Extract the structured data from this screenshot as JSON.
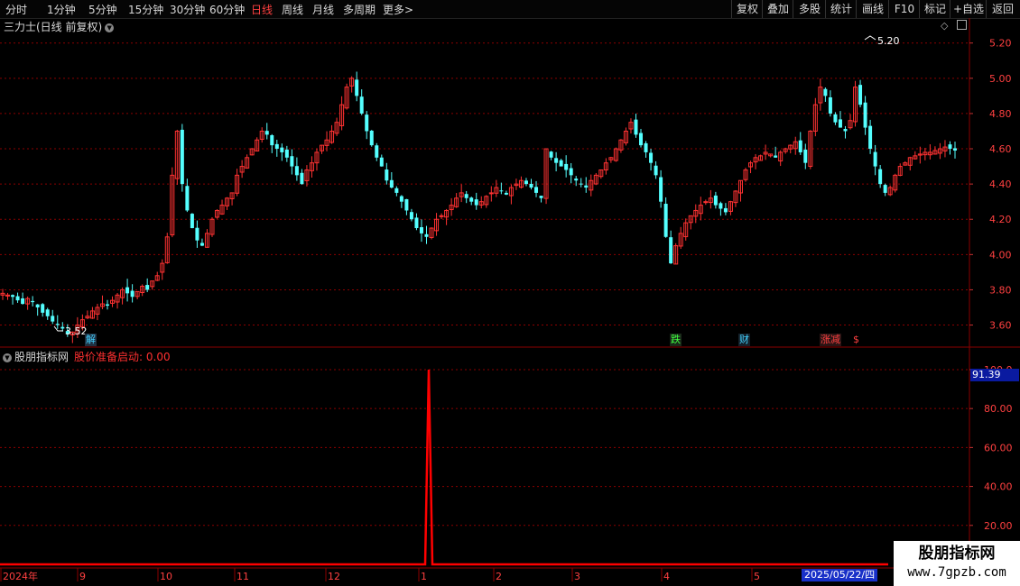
{
  "toolbar": {
    "periods": [
      {
        "label": "分时",
        "active": false
      },
      {
        "label": "1分钟",
        "active": false
      },
      {
        "label": "5分钟",
        "active": false
      },
      {
        "label": "15分钟",
        "active": false
      },
      {
        "label": "30分钟",
        "active": false
      },
      {
        "label": "60分钟",
        "active": false
      },
      {
        "label": "日线",
        "active": true
      },
      {
        "label": "周线",
        "active": false
      },
      {
        "label": "月线",
        "active": false
      },
      {
        "label": "多周期",
        "active": false
      },
      {
        "label": "更多",
        "active": false
      }
    ],
    "more_arrow": ">",
    "right_buttons": [
      "复权",
      "叠加",
      "多股",
      "统计",
      "画线",
      "F10",
      "标记",
      "+自选",
      "返回"
    ]
  },
  "stock_header": {
    "title": "三力士(日线 前复权)",
    "dropdown_icon": "chevron-down-icon"
  },
  "price_axis": {
    "ticks": [
      "5.20",
      "5.00",
      "4.80",
      "4.60",
      "4.40",
      "4.20",
      "4.00",
      "3.80",
      "3.60"
    ]
  },
  "annotations": {
    "high": "5.20",
    "low": "3.52"
  },
  "signals": [
    {
      "label": "解",
      "color": "#40d0ff"
    },
    {
      "label": "跌",
      "color": "#40ff40"
    },
    {
      "label": "财",
      "color": "#40d0ff"
    },
    {
      "label": "涨减",
      "color": "#ff4040"
    },
    {
      "label": "$",
      "color": "#ff4040"
    }
  ],
  "indicator": {
    "name": "股朋指标网",
    "formula_label": "股价准备启动:",
    "formula_value": "0.00",
    "current_value": "91.39",
    "axis_ticks": [
      "100.0",
      "80.00",
      "60.00",
      "40.00",
      "20.00"
    ]
  },
  "time_axis": {
    "labels": [
      "2024年",
      "9",
      "10",
      "11",
      "12",
      "1",
      "2",
      "3",
      "4",
      "5"
    ],
    "cursor_date": "2025/05/22/四"
  },
  "watermark": {
    "title": "股朋指标网",
    "url": "www.7gpzb.com"
  },
  "colors": {
    "up": "#ff3232",
    "down": "#54ffff",
    "grid": "#8b0000",
    "signal_line": "#ff0000"
  },
  "chart_data": [
    {
      "type": "candlestick",
      "title": "三力士(日线 前复权)",
      "y_axis_ticks": [
        5.2,
        5.0,
        4.8,
        4.6,
        4.4,
        4.2,
        4.0,
        3.8,
        3.6
      ],
      "ylim": [
        3.48,
        5.26
      ],
      "x_axis_labels": [
        "2024年",
        "9",
        "10",
        "11",
        "12",
        "1",
        "2",
        "3",
        "4",
        "5"
      ],
      "high_marker": 5.2,
      "low_marker": 3.52,
      "close_series": [
        3.78,
        3.77,
        3.76,
        3.74,
        3.72,
        3.75,
        3.73,
        3.7,
        3.67,
        3.65,
        3.62,
        3.6,
        3.58,
        3.55,
        3.56,
        3.6,
        3.63,
        3.65,
        3.68,
        3.7,
        3.72,
        3.71,
        3.74,
        3.77,
        3.8,
        3.78,
        3.76,
        3.79,
        3.82,
        3.8,
        3.85,
        3.88,
        3.95,
        4.1,
        4.45,
        4.7,
        4.4,
        4.25,
        4.15,
        4.08,
        4.05,
        4.12,
        4.2,
        4.25,
        4.28,
        4.32,
        4.35,
        4.45,
        4.5,
        4.55,
        4.6,
        4.65,
        4.7,
        4.68,
        4.62,
        4.6,
        4.58,
        4.55,
        4.5,
        4.45,
        4.4,
        4.48,
        4.52,
        4.58,
        4.62,
        4.65,
        4.7,
        4.75,
        4.85,
        4.95,
        5.0,
        4.9,
        4.8,
        4.7,
        4.62,
        4.55,
        4.5,
        4.42,
        4.38,
        4.35,
        4.3,
        4.25,
        4.2,
        4.15,
        4.12,
        4.1,
        4.15,
        4.2,
        4.22,
        4.25,
        4.28,
        4.32,
        4.35,
        4.32,
        4.3,
        4.28,
        4.3,
        4.33,
        4.35,
        4.38,
        4.36,
        4.34,
        4.38,
        4.4,
        4.42,
        4.4,
        4.38,
        4.35,
        4.32,
        4.6,
        4.55,
        4.52,
        4.5,
        4.48,
        4.45,
        4.42,
        4.4,
        4.38,
        4.42,
        4.45,
        4.48,
        4.52,
        4.55,
        4.6,
        4.65,
        4.7,
        4.75,
        4.68,
        4.62,
        4.58,
        4.52,
        4.45,
        4.3,
        4.1,
        3.95,
        4.05,
        4.12,
        4.18,
        4.22,
        4.25,
        4.28,
        4.3,
        4.32,
        4.28,
        4.26,
        4.24,
        4.3,
        4.36,
        4.42,
        4.48,
        4.52,
        4.55,
        4.56,
        4.58,
        4.57,
        4.55,
        4.58,
        4.6,
        4.62,
        4.64,
        4.58,
        4.52,
        4.7,
        4.85,
        4.95,
        4.9,
        4.8,
        4.75,
        4.72,
        4.7,
        4.76,
        4.95,
        4.85,
        4.72,
        4.6,
        4.5,
        4.4,
        4.35,
        4.38,
        4.45,
        4.5,
        4.52,
        4.55,
        4.56,
        4.57,
        4.58,
        4.58,
        4.59,
        4.6,
        4.61,
        4.6,
        4.59
      ]
    },
    {
      "type": "line",
      "title": "股朋指标网",
      "series": [
        {
          "name": "股价准备启动",
          "peak_value": 100,
          "baseline": 0
        }
      ],
      "y_axis_ticks": [
        100,
        80,
        60,
        40,
        20
      ],
      "ylim": [
        0,
        106
      ]
    }
  ]
}
